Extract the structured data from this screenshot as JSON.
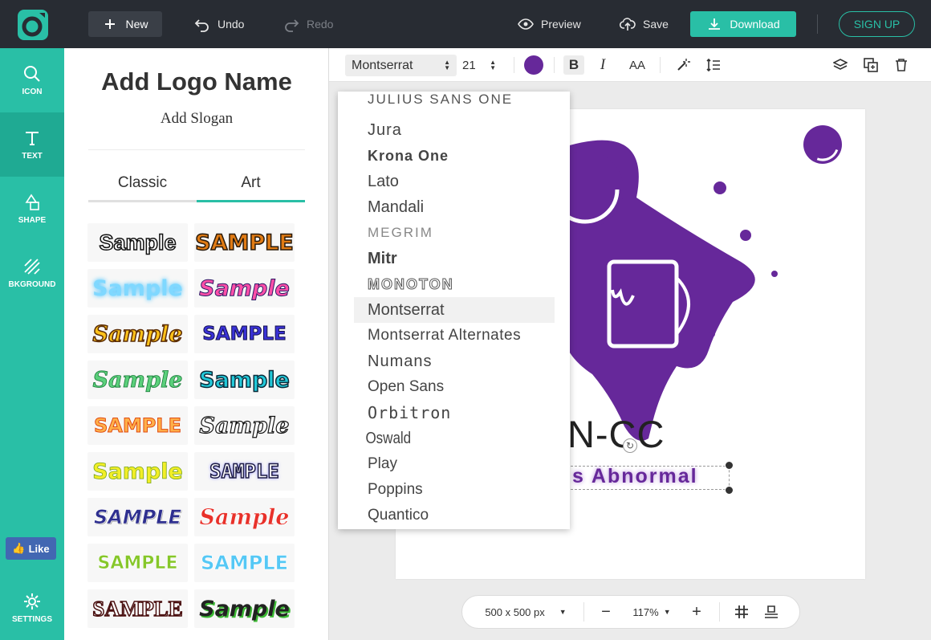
{
  "topbar": {
    "new_label": "New",
    "undo_label": "Undo",
    "redo_label": "Redo",
    "preview_label": "Preview",
    "save_label": "Save",
    "download_label": "Download",
    "signup_label": "SIGN UP"
  },
  "rail": {
    "icon_label": "ICON",
    "text_label": "TEXT",
    "shape_label": "SHAPE",
    "background_label": "BKGROUND",
    "like_label": "Like",
    "settings_label": "SETTINGS"
  },
  "panel": {
    "title": "Add Logo Name",
    "slogan": "Add Slogan",
    "tab_classic": "Classic",
    "tab_art": "Art",
    "samples": [
      "Sample",
      "SAMPLE",
      "Sample",
      "Sample",
      "Sample",
      "SAMPLE",
      "Sample",
      "Sample",
      "SAMPLE",
      "Sample",
      "Sample",
      "SAMPLE",
      "SAMPLE",
      "Sample",
      "SAMPLE",
      "SAMPLE",
      "SAMPLE",
      "Sample"
    ]
  },
  "format": {
    "font": "Montserrat",
    "size": "21",
    "color": "#66289a",
    "bold": "B",
    "italic": "I",
    "case": "AA"
  },
  "fonts": [
    "JULIUS SANS ONE",
    "Jura",
    "Krona One",
    "Lato",
    "Mandali",
    "MEGRIM",
    "Mitr",
    "MONOTON",
    "Montserrat",
    "Montserrat Alternates",
    "Numans",
    "Open Sans",
    "Orbitron",
    "Oswald",
    "Play",
    "Poppins",
    "Quantico"
  ],
  "selected_font": "Montserrat",
  "canvas": {
    "brand": "SIGN-CC",
    "slogan": "s Abnormal"
  },
  "zoom": {
    "canvas_size": "500 x 500 px",
    "zoom_level": "117%"
  },
  "colors": {
    "accent": "#29bfa6",
    "topbar": "#282c33",
    "purple": "#66289a"
  }
}
